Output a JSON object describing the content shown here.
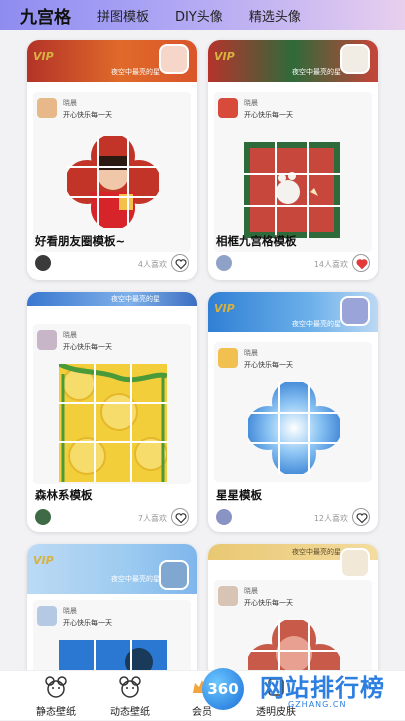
{
  "tabs": [
    {
      "label": "九宫格"
    },
    {
      "label": "拼图模板"
    },
    {
      "label": "DIY头像"
    },
    {
      "label": "精选头像"
    }
  ],
  "cards": [
    {
      "vip": "VIP",
      "banner_text": "夜空中最亮的星",
      "author": "晓晨",
      "signature": "开心快乐每一天",
      "title": "好看朋友圈模板~",
      "likes": "4人喜欢",
      "liked": false,
      "accent": "#b3302c"
    },
    {
      "vip": "VIP",
      "banner_text": "夜空中最亮的星",
      "author": "晓晨",
      "signature": "开心快乐每一天",
      "title": "相框九宫格模板",
      "likes": "14人喜欢",
      "liked": true,
      "accent": "#2e6b3a"
    },
    {
      "vip": "",
      "banner_text": "夜空中最亮的星",
      "author": "晓晨",
      "signature": "开心快乐每一天",
      "title": "森林系模板",
      "likes": "7人喜欢",
      "liked": false,
      "accent": "#e8c63c"
    },
    {
      "vip": "VIP",
      "banner_text": "夜空中最亮的星",
      "author": "晓晨",
      "signature": "开心快乐每一天",
      "title": "星星模板",
      "likes": "12人喜欢",
      "liked": false,
      "accent": "#3f8fd8"
    },
    {
      "vip": "VIP",
      "banner_text": "夜空中最亮的星",
      "author": "晓晨",
      "signature": "开心快乐每一天"
    },
    {
      "vip": "",
      "banner_text": "夜空中最亮的星",
      "author": "晓晨",
      "signature": "开心快乐每一天"
    }
  ],
  "bottom_nav": [
    {
      "label": "静态壁纸",
      "icon": "bear-icon"
    },
    {
      "label": "动态壁纸",
      "icon": "bear-icon"
    },
    {
      "label": "会员",
      "icon": "crown-icon"
    },
    {
      "label": "透明皮肤",
      "icon": "skin-icon"
    }
  ],
  "watermark": {
    "logo": "360",
    "text": "网站排行榜",
    "sub": "GZHANG.CN"
  }
}
